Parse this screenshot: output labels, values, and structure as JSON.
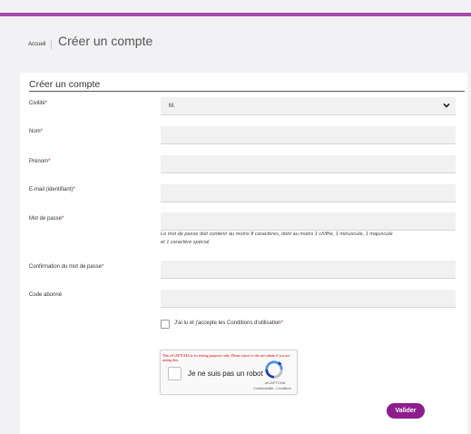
{
  "breadcrumb": {
    "home": "Accueil",
    "separator": "|",
    "current": "Créer un compte"
  },
  "form": {
    "title": "Créer un compte",
    "required_marker": "*",
    "civilite": {
      "label": "Civilité",
      "value": "M."
    },
    "nom": {
      "label": "Nom",
      "value": ""
    },
    "prenom": {
      "label": "Prénom",
      "value": ""
    },
    "email": {
      "label": "E-mail (identifiant)",
      "value": ""
    },
    "password": {
      "label": "Mot de passe",
      "value": "",
      "hint_line1": "Le mot de passe doit contenir au moins 8 caractères, dont au moins 1 chiffre, 1 minuscule, 1 majuscule",
      "hint_line2": "et 1 caractère spécial"
    },
    "password_confirm": {
      "label": "Confirmation du mot de passe",
      "value": ""
    },
    "code_abonne": {
      "label": "Code abonné",
      "value": ""
    },
    "cgu": {
      "label": "J'ai lu et j'accepte les Conditions d'utilisation",
      "checked": false
    },
    "submit_label": "Valider"
  },
  "recaptcha": {
    "warning": "This reCAPTCHA is for testing purposes only. Please report to the site admin if you are seeing this.",
    "label": "Je ne suis pas un robot",
    "brand": "reCAPTCHA",
    "links": "Confidentialité - Conditions",
    "checked": false
  },
  "colors": {
    "accent": "#a64ba6",
    "button": "#8c1e8c",
    "required": "#d40000",
    "field_bg": "#f1f1f1"
  },
  "icons": {
    "select": "chevron-down-icon",
    "captcha": "recaptcha-logo-icon"
  }
}
